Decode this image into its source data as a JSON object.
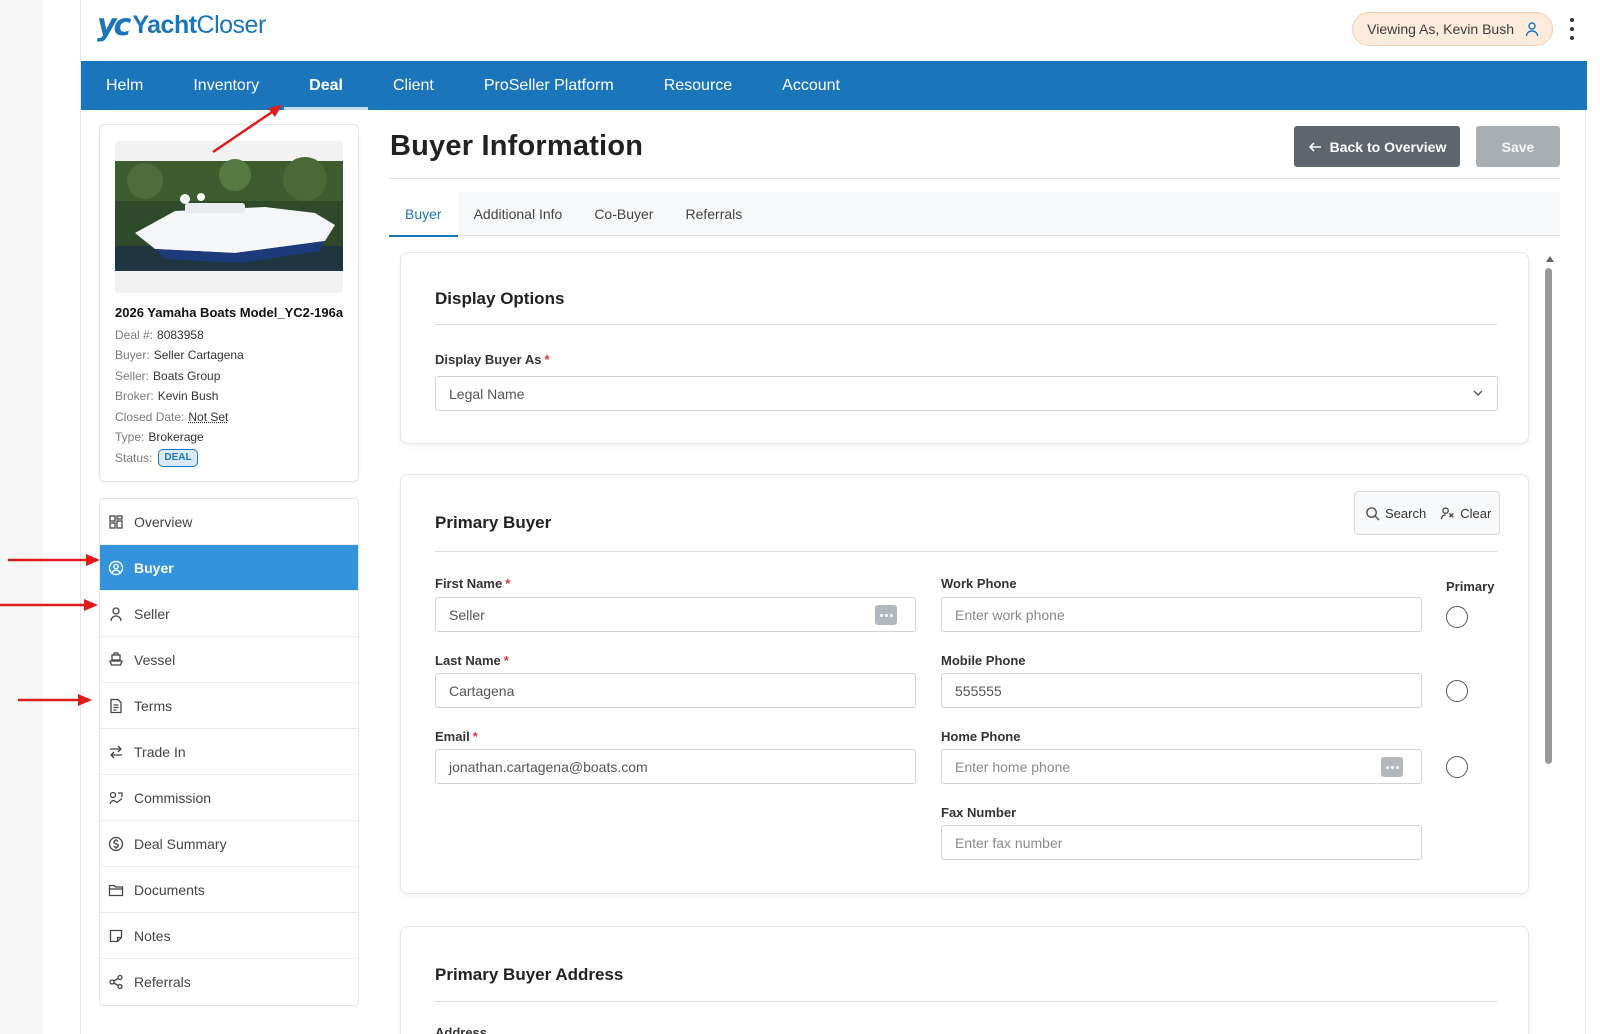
{
  "brand": {
    "mark": "yc",
    "name_bold": "Yacht",
    "name_light": "Closer"
  },
  "viewing_as": "Viewing As, Kevin Bush",
  "nav": [
    "Helm",
    "Inventory",
    "Deal",
    "Client",
    "ProSeller Platform",
    "Resource",
    "Account"
  ],
  "nav_active": "Deal",
  "deal": {
    "title": "2026 Yamaha Boats Model_YC2-196a",
    "fields": [
      {
        "k": "Deal #:",
        "v": "8083958"
      },
      {
        "k": "Buyer:",
        "v": "Seller Cartagena"
      },
      {
        "k": "Seller:",
        "v": "Boats Group"
      },
      {
        "k": "Broker:",
        "v": "Kevin Bush"
      },
      {
        "k": "Closed Date:",
        "v": "Not Set"
      },
      {
        "k": "Type:",
        "v": "Brokerage"
      }
    ],
    "status_label": "Status:",
    "status_badge": "DEAL"
  },
  "sidebar": [
    {
      "label": "Overview",
      "icon": "grid-icon"
    },
    {
      "label": "Buyer",
      "icon": "user-circle-icon",
      "active": true
    },
    {
      "label": "Seller",
      "icon": "user-icon"
    },
    {
      "label": "Vessel",
      "icon": "ship-icon"
    },
    {
      "label": "Terms",
      "icon": "document-icon"
    },
    {
      "label": "Trade In",
      "icon": "swap-icon"
    },
    {
      "label": "Commission",
      "icon": "commission-icon"
    },
    {
      "label": "Deal Summary",
      "icon": "dollar-circle-icon"
    },
    {
      "label": "Documents",
      "icon": "folder-icon"
    },
    {
      "label": "Notes",
      "icon": "note-icon"
    },
    {
      "label": "Referrals",
      "icon": "share-icon"
    }
  ],
  "page_title": "Buyer Information",
  "buttons": {
    "back": "Back to Overview",
    "save": "Save"
  },
  "tabs": [
    "Buyer",
    "Additional Info",
    "Co-Buyer",
    "Referrals"
  ],
  "tab_active": "Buyer",
  "display_options": {
    "title": "Display Options",
    "label": "Display Buyer As",
    "value": "Legal Name"
  },
  "primary_buyer": {
    "title": "Primary Buyer",
    "search": "Search",
    "clear": "Clear",
    "primary_label": "Primary",
    "first_name": {
      "label": "First Name",
      "value": "Seller"
    },
    "last_name": {
      "label": "Last Name",
      "value": "Cartagena"
    },
    "email": {
      "label": "Email",
      "value": "jonathan.cartagena@boats.com"
    },
    "work_phone": {
      "label": "Work Phone",
      "placeholder": "Enter work phone"
    },
    "mobile_phone": {
      "label": "Mobile Phone",
      "value": "555555"
    },
    "home_phone": {
      "label": "Home Phone",
      "placeholder": "Enter home phone"
    },
    "fax": {
      "label": "Fax Number",
      "placeholder": "Enter fax number"
    }
  },
  "address": {
    "title": "Primary Buyer Address",
    "label": "Address"
  },
  "colors": {
    "brand": "#1b75bb",
    "active_side": "#3394dc",
    "annotation": "#e01b1b"
  }
}
